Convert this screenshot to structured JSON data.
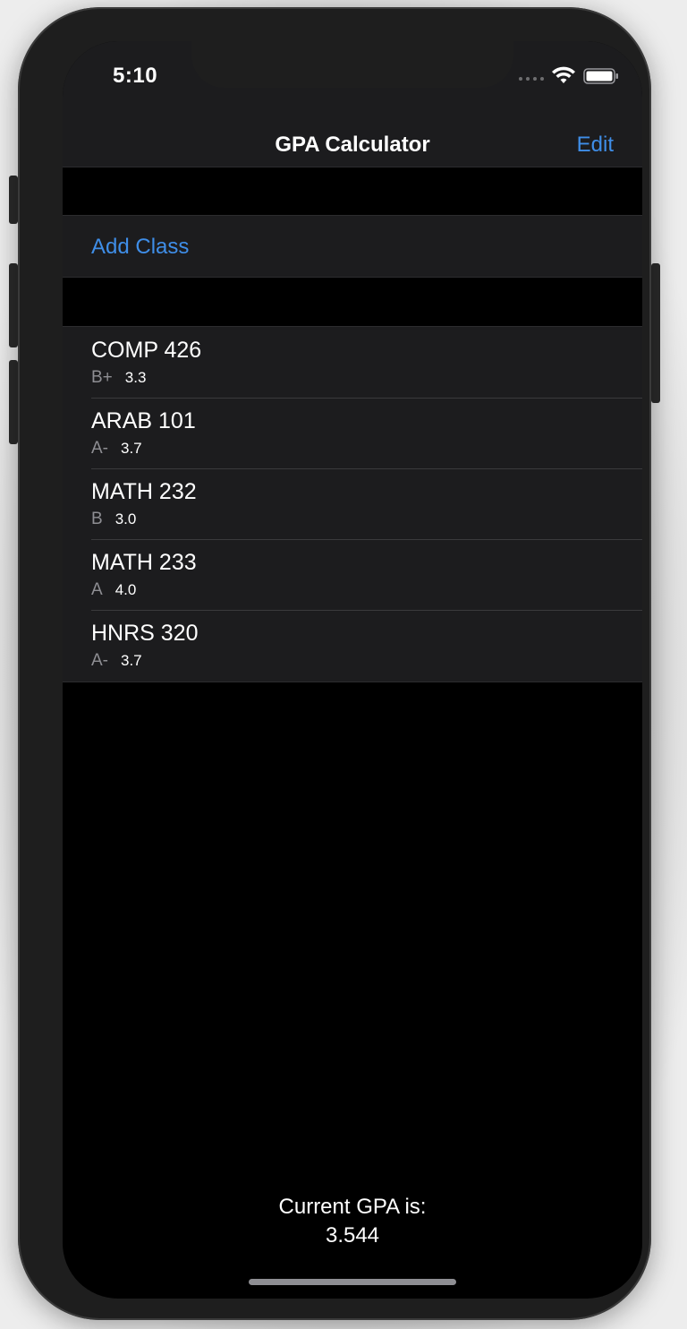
{
  "status_bar": {
    "time": "5:10"
  },
  "nav": {
    "title": "GPA Calculator",
    "edit_label": "Edit"
  },
  "actions": {
    "add_class_label": "Add Class"
  },
  "classes": [
    {
      "name": "COMP 426",
      "grade": "B+",
      "points": "3.3"
    },
    {
      "name": "ARAB 101",
      "grade": "A-",
      "points": "3.7"
    },
    {
      "name": "MATH 232",
      "grade": "B",
      "points": "3.0"
    },
    {
      "name": "MATH 233",
      "grade": "A",
      "points": "4.0"
    },
    {
      "name": "HNRS 320",
      "grade": "A-",
      "points": "3.7"
    }
  ],
  "summary": {
    "label": "Current GPA is:",
    "value": "3.544"
  },
  "colors": {
    "accent": "#3f8ee8",
    "background": "#000000",
    "cell": "#1c1c1e",
    "secondary_text": "#8e8e93"
  },
  "icons": [
    "wifi-icon",
    "battery-icon",
    "signal-dots-icon"
  ]
}
